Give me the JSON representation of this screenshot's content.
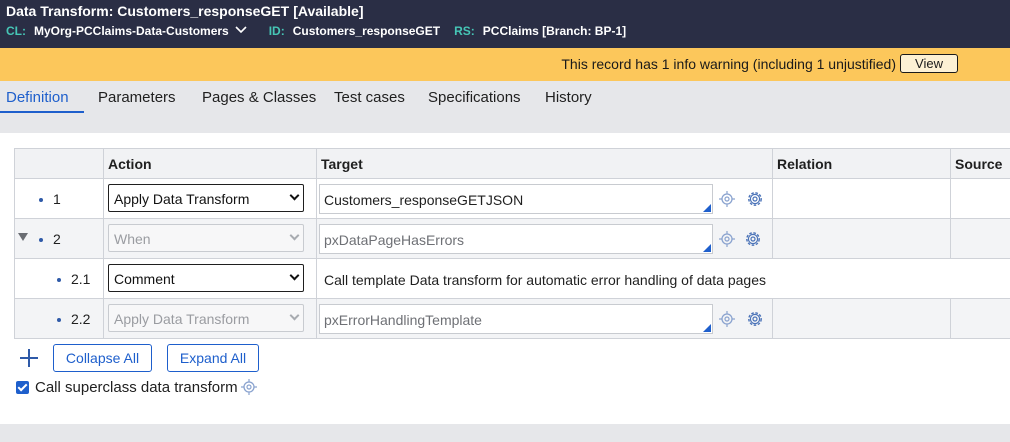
{
  "header": {
    "title": "Data Transform: Customers_responseGET",
    "status": "[Available]",
    "cl_label": "CL:",
    "cl_value": "MyOrg-PCClaims-Data-Customers",
    "id_label": "ID:",
    "id_value": "Customers_responseGET",
    "rs_label": "RS:",
    "rs_value": "PCClaims [Branch: BP-1]"
  },
  "warning": {
    "text": "This record has 1 info warning (including 1 unjustified)",
    "view_label": "View"
  },
  "tabs": [
    {
      "label": "Definition",
      "active": true
    },
    {
      "label": "Parameters"
    },
    {
      "label": "Pages & Classes"
    },
    {
      "label": "Test cases"
    },
    {
      "label": "Specifications"
    },
    {
      "label": "History"
    }
  ],
  "grid": {
    "columns": [
      "Action",
      "Target",
      "Relation",
      "Source"
    ],
    "rows": [
      {
        "num": "1",
        "action": "Apply Data Transform",
        "target": "Customers_responseGETJSON",
        "disabled": false
      },
      {
        "num": "2",
        "action": "When",
        "target": "pxDataPageHasErrors",
        "disabled": true,
        "expandable": true
      },
      {
        "num": "2.1",
        "action": "Comment",
        "target": "Call template Data transform for automatic error handling of data pages",
        "disabled": false
      },
      {
        "num": "2.2",
        "action": "Apply Data Transform",
        "target": "pxErrorHandlingTemplate",
        "disabled": true
      }
    ]
  },
  "actions": {
    "collapse_all": "Collapse All",
    "expand_all": "Expand All"
  },
  "superclass": {
    "label": "Call superclass data transform",
    "checked": true
  },
  "colors": {
    "header_bg": "#2a2e45",
    "header_key": "#46c6b6",
    "warning_bg": "#fcc75b",
    "accent": "#1e5fcc"
  }
}
